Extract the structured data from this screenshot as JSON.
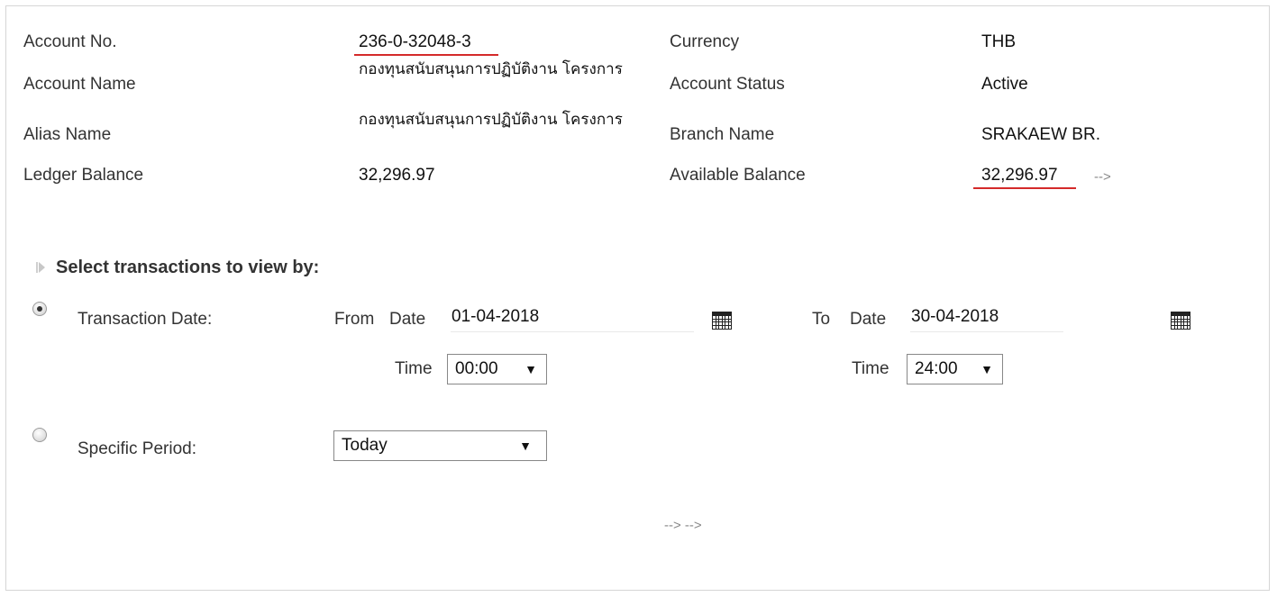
{
  "account": {
    "account_no_label": "Account No.",
    "account_no": "236-0-32048-3",
    "currency_label": "Currency",
    "currency": "THB",
    "account_name_label": "Account Name",
    "account_name": "กองทุนสนับสนุนการปฏิบัติงาน โครงการ",
    "account_status_label": "Account Status",
    "account_status": "Active",
    "alias_name_label": "Alias Name",
    "alias_name": "กองทุนสนับสนุนการปฏิบัติงาน โครงการ",
    "branch_name_label": "Branch Name",
    "branch_name": "SRAKAEW BR.",
    "ledger_balance_label": "Ledger Balance",
    "ledger_balance": "32,296.97",
    "available_balance_label": "Available Balance",
    "available_balance": "32,296.97",
    "available_balance_arrow": "-->"
  },
  "filter": {
    "section_title": "Select transactions to view by:",
    "transaction_date_label": "Transaction Date:",
    "from_label": "From",
    "from_date_label": "Date",
    "from_date": "01-04-2018",
    "from_time_label": "Time",
    "from_time": "00:00",
    "to_label": "To",
    "to_date_label": "Date",
    "to_date": "30-04-2018",
    "to_time_label": "Time",
    "to_time": "24:00",
    "specific_period_label": "Specific Period:",
    "specific_period_value": "Today",
    "transaction_date_selected": true,
    "specific_period_selected": false
  },
  "footer": {
    "arrows": "--> -->"
  },
  "icons": {
    "from_calendar": "calendar-icon",
    "to_calendar": "calendar-icon",
    "dropdown_caret": "▼"
  },
  "colors": {
    "underline_accent": "#d42a2a"
  }
}
